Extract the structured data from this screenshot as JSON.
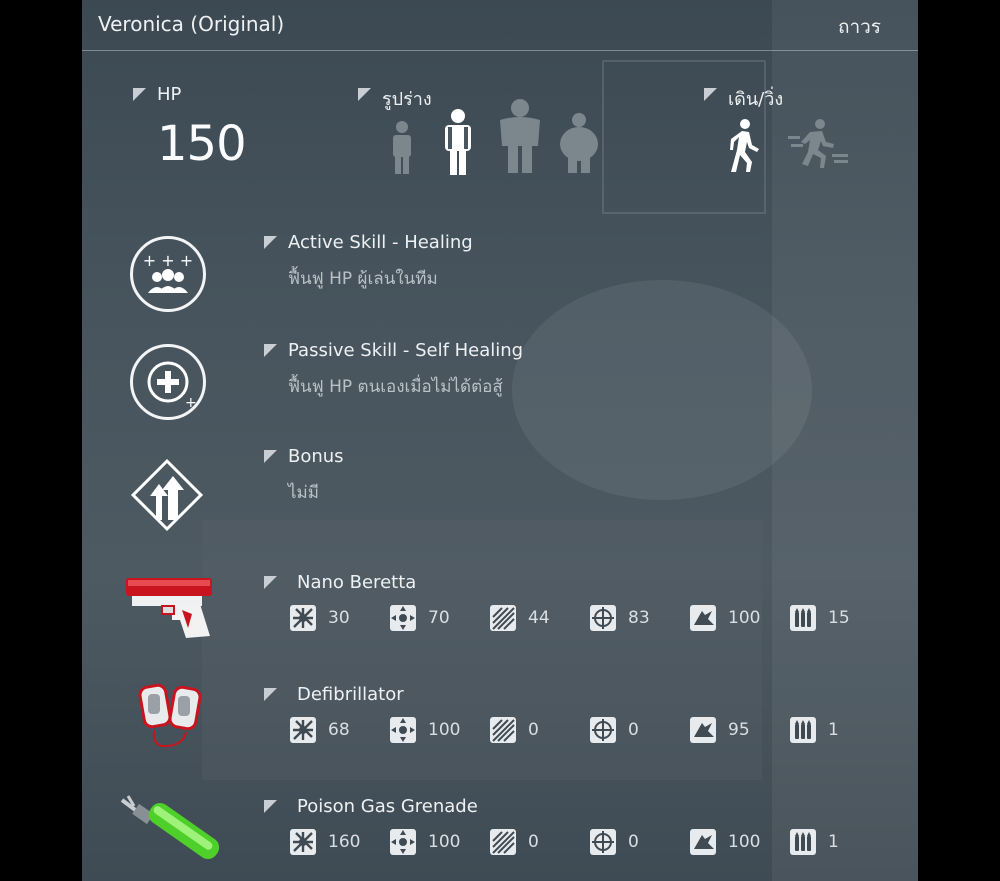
{
  "header": {
    "title": "Veronica (Original)",
    "duration": "ถาวร"
  },
  "hp": {
    "label": "HP",
    "value": "150"
  },
  "body_type": {
    "label": "รูปร่าง",
    "options": [
      "small",
      "medium",
      "large",
      "fat"
    ],
    "selected": "medium"
  },
  "movement": {
    "label": "เดิน/วิ่ง",
    "options": [
      "walk",
      "run"
    ],
    "selected": "walk"
  },
  "skills": [
    {
      "icon": "team-healing-icon",
      "title": "Active Skill - Healing",
      "desc": "ฟื้นฟู HP ผู้เล่นในทีม"
    },
    {
      "icon": "self-healing-icon",
      "title": "Passive Skill - Self Healing",
      "desc": "ฟื้นฟู HP ตนเองเมื่อไม่ได้ต่อสู้"
    },
    {
      "icon": "bonus-arrows-icon",
      "title": "Bonus",
      "desc": "ไม่มี"
    }
  ],
  "stat_icons": [
    "damage-icon",
    "accuracy-icon",
    "fire-rate-icon",
    "crosshair-icon",
    "mobility-icon",
    "ammo-icon"
  ],
  "weapons": [
    {
      "name": "Nano Beretta",
      "icon": "pistol-icon",
      "stats": [
        "30",
        "70",
        "44",
        "83",
        "100",
        "15"
      ]
    },
    {
      "name": "Defibrillator",
      "icon": "defibrillator-icon",
      "stats": [
        "68",
        "100",
        "0",
        "0",
        "95",
        "1"
      ]
    },
    {
      "name": "Poison Gas Grenade",
      "icon": "gas-grenade-icon",
      "stats": [
        "160",
        "100",
        "0",
        "0",
        "100",
        "1"
      ]
    }
  ]
}
